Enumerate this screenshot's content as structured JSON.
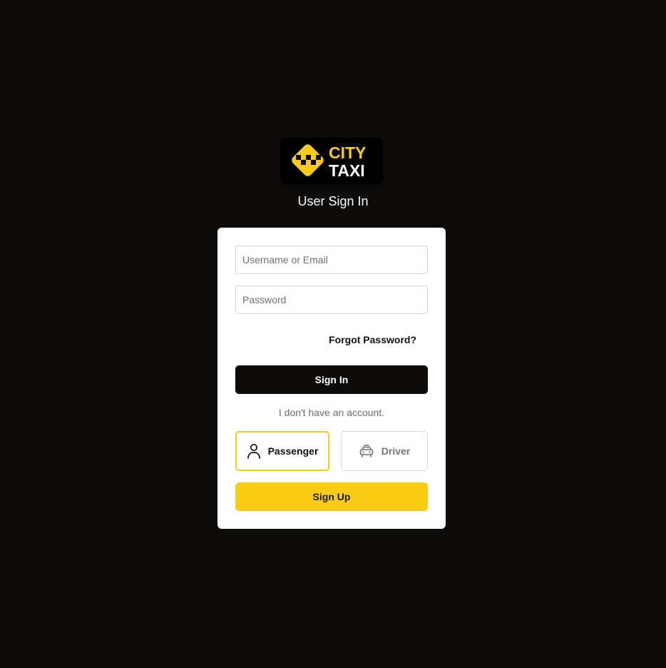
{
  "logo": {
    "line1": "CITY",
    "line2": "TAXI",
    "colors": {
      "background": "#000000",
      "accent": "#facc15",
      "text_line2": "#ffffff"
    }
  },
  "page_title": "User Sign In",
  "form": {
    "username": {
      "placeholder": "Username or Email",
      "value": ""
    },
    "password": {
      "placeholder": "Password",
      "value": ""
    },
    "forgot_password_label": "Forgot Password?",
    "sign_in_label": "Sign In",
    "no_account_text": "I don't have an account.",
    "roles": [
      {
        "label": "Passenger",
        "icon": "person-icon",
        "selected": true
      },
      {
        "label": "Driver",
        "icon": "taxi-car-icon",
        "selected": false
      }
    ],
    "sign_up_label": "Sign Up"
  },
  "colors": {
    "page_background": "#0c0b0a",
    "card_background": "#ffffff",
    "primary_button": "#0c0b0a",
    "accent": "#facc15",
    "muted_text": "#6d6d6d"
  }
}
